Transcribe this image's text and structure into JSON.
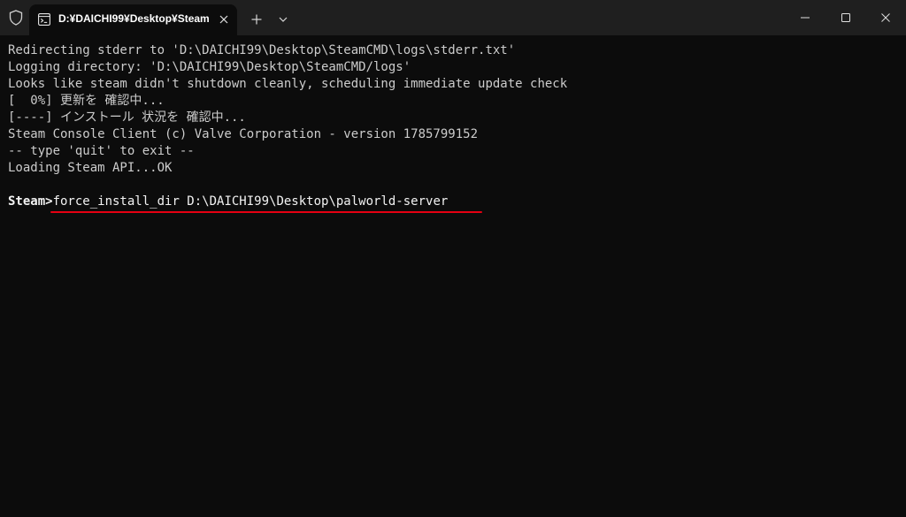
{
  "window": {
    "tab_title": "D:¥DAICHI99¥Desktop¥Steam",
    "tab_icon": "terminal-icon",
    "colors": {
      "titlebar": "#1f1f1f",
      "terminal_bg": "#0c0c0c",
      "text": "#cccccc",
      "annotation_underline": "#e60012"
    }
  },
  "terminal": {
    "lines": [
      "Redirecting stderr to 'D:\\DAICHI99\\Desktop\\SteamCMD\\logs\\stderr.txt'",
      "Logging directory: 'D:\\DAICHI99\\Desktop\\SteamCMD/logs'",
      "Looks like steam didn't shutdown cleanly, scheduling immediate update check",
      "[  0%] 更新を 確認中...",
      "[----] インストール 状況を 確認中...",
      "Steam Console Client (c) Valve Corporation - version 1785799152",
      "-- type 'quit' to exit --",
      "Loading Steam API...OK"
    ],
    "prompt": "Steam>",
    "command": "force_install_dir D:\\DAICHI99\\Desktop\\palworld-server"
  }
}
